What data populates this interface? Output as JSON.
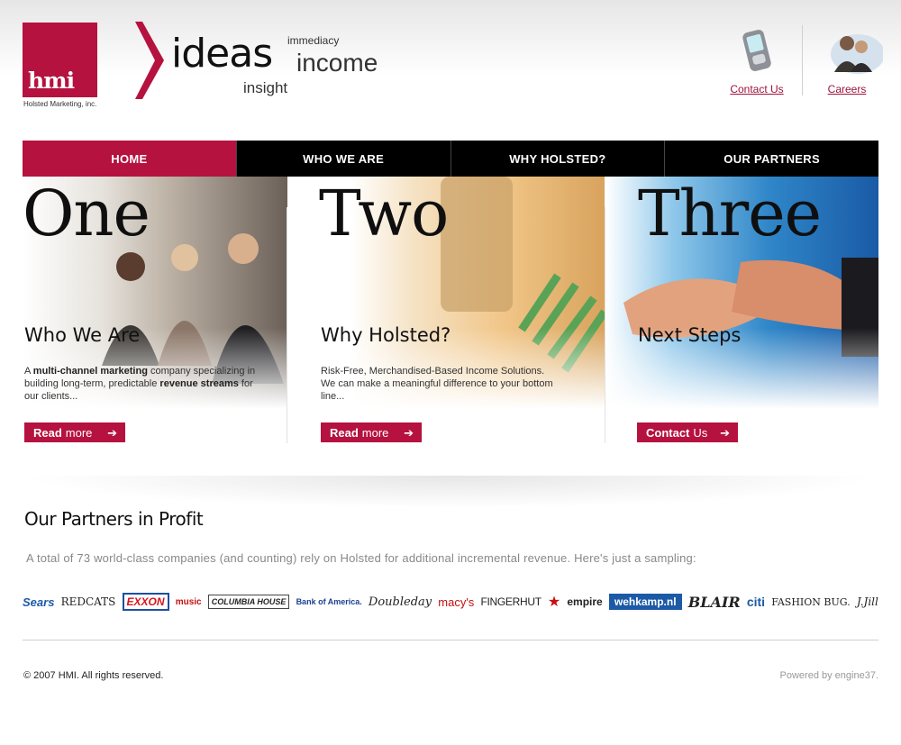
{
  "header": {
    "logo_text": "hmi",
    "logo_caption": "Holsted Marketing, inc.",
    "tagline": {
      "ideas": "ideas",
      "immediacy": "immediacy",
      "income": "income",
      "insight": "insight"
    },
    "brand_color": "#b5123f",
    "contact_label": "Contact Us",
    "careers_label": "Careers",
    "contact_icon": "pda-phone-icon",
    "careers_icon": "people-photo-icon"
  },
  "nav": {
    "items": [
      {
        "label": "HOME",
        "active": true
      },
      {
        "label": "WHO WE ARE",
        "active": false
      },
      {
        "label": "WHY HOLSTED?",
        "active": false
      },
      {
        "label": "OUR PARTNERS",
        "active": false
      }
    ]
  },
  "panels": [
    {
      "number": "One",
      "title": "Who We Are",
      "desc_parts": [
        "A ",
        "multi-channel marketing",
        " company specializing in building long-term, predictable ",
        "revenue streams",
        " for our clients..."
      ],
      "button_strong": "Read",
      "button_rest": "more"
    },
    {
      "number": "Two",
      "title": "Why Holsted?",
      "desc_line1": "Risk-Free, Merchandised-Based Income Solutions.",
      "desc_line2": "We can make a meaningful difference to your bottom line...",
      "button_strong": "Read",
      "button_rest": "more"
    },
    {
      "number": "Three",
      "title": "Next Steps",
      "button_strong": "Contact",
      "button_rest": "Us"
    }
  ],
  "partners": {
    "heading": "Our Partners in Profit",
    "intro": "A total of 73 world-class companies (and counting) rely on Holsted for additional incremental revenue. Here's just a sampling:",
    "logos": [
      "Sears",
      "REDCATS",
      "EXXON",
      "music",
      "COLUMBIA HOUSE",
      "Bank of America.",
      "Doubleday",
      "macy's",
      "FINGERHUT",
      "★",
      "empire",
      "wehkamp.nl",
      "BLAIR",
      "citi",
      "FASHION BUG.",
      "J.Jill"
    ]
  },
  "footer": {
    "copyright": "© 2007 HMI. All rights reserved.",
    "powered": "Powered by engine37."
  }
}
